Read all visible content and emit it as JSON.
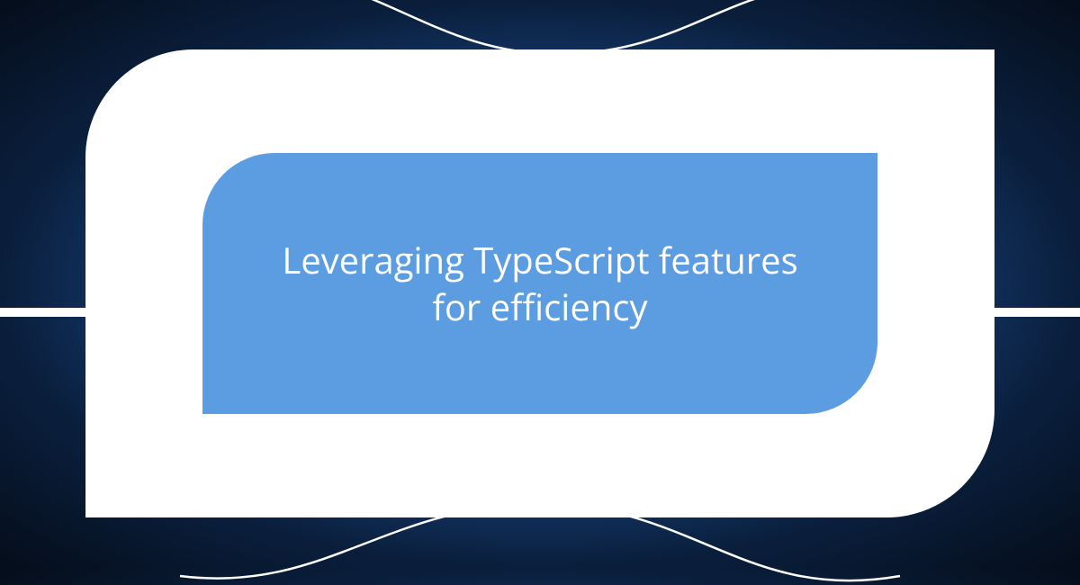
{
  "card": {
    "title": "Leveraging TypeScript features for efficiency"
  },
  "colors": {
    "inner_panel": "#5c9ce0",
    "frame": "#ffffff",
    "text": "#ffffff"
  }
}
